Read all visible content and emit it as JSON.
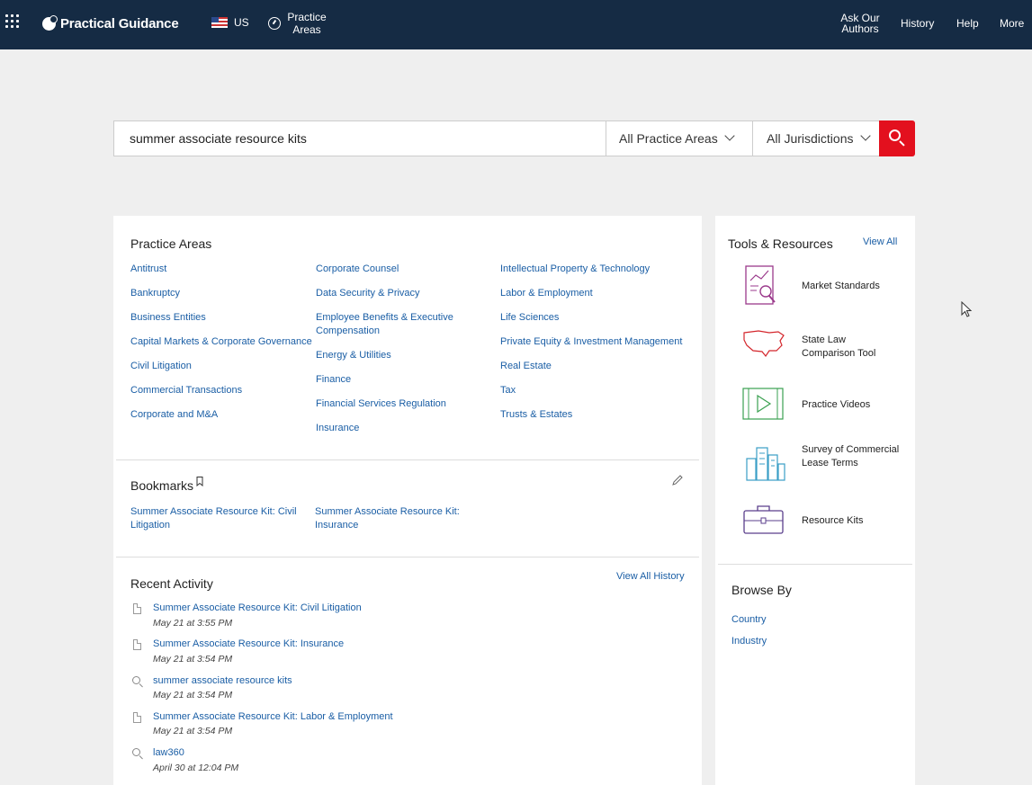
{
  "header": {
    "brand": "Practical Guidance",
    "region": "US",
    "practice_areas": "Practice Areas",
    "nav": [
      "Ask Our Authors",
      "History",
      "Help",
      "More"
    ]
  },
  "search": {
    "query": "summer associate resource kits",
    "practice_filter": "All Practice Areas",
    "jurisdiction_filter": "All Jurisdictions"
  },
  "practice_areas": {
    "title": "Practice Areas",
    "col1": [
      "Antitrust",
      "Bankruptcy",
      "Business Entities",
      "Capital Markets & Corporate Governance",
      "Civil Litigation",
      "Commercial Transactions",
      "Corporate and M&A"
    ],
    "col2": [
      "Corporate Counsel",
      "Data Security & Privacy",
      "Employee Benefits & Executive Compensation",
      "Energy & Utilities",
      "Finance",
      "Financial Services Regulation",
      "Insurance"
    ],
    "col3": [
      "Intellectual Property & Technology",
      "Labor & Employment",
      "Life Sciences",
      "Private Equity & Investment Management",
      "Real Estate",
      "Tax",
      "Trusts & Estates"
    ]
  },
  "bookmarks": {
    "title": "Bookmarks",
    "items": [
      "Summer Associate Resource Kit: Civil Litigation",
      "Summer Associate Resource Kit: Insurance"
    ]
  },
  "recent": {
    "title": "Recent Activity",
    "view_all": "View All History",
    "items": [
      {
        "label": "Summer Associate Resource Kit: Civil Litigation",
        "date": "May 21 at 3:55 PM"
      },
      {
        "label": "Summer Associate Resource Kit: Insurance",
        "date": "May 21 at 3:54 PM"
      },
      {
        "label": "summer associate resource kits",
        "date": "May 21 at 3:54 PM"
      },
      {
        "label": "Summer Associate Resource Kit: Labor & Employment",
        "date": "May 21 at 3:54 PM"
      },
      {
        "label": "law360",
        "date": "April 30 at 12:04 PM"
      }
    ]
  },
  "tools": {
    "title": "Tools & Resources",
    "view_all": "View All",
    "items": [
      "Market Standards",
      "State Law Comparison Tool",
      "Practice Videos",
      "Survey of Commercial Lease Terms",
      "Resource Kits"
    ]
  },
  "browse": {
    "title": "Browse By",
    "items": [
      "Country",
      "Industry"
    ]
  }
}
